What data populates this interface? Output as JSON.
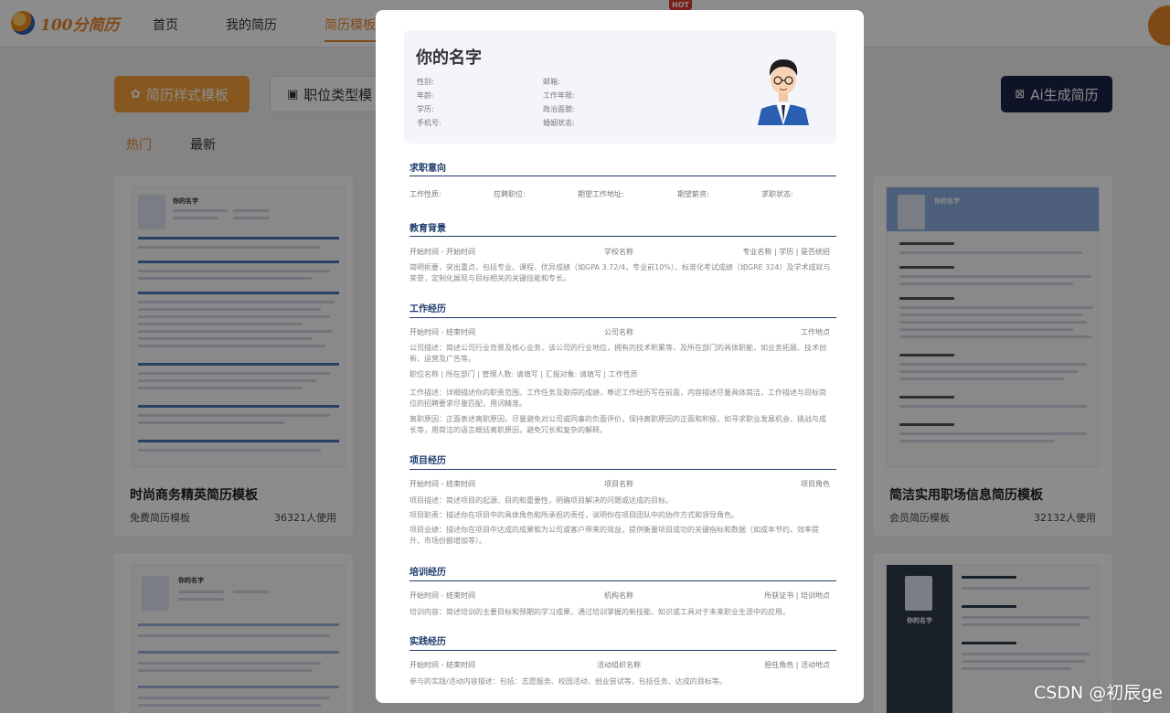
{
  "brand": {
    "logo_text": "100分简历"
  },
  "nav": {
    "items": [
      "首页",
      "我的简历",
      "简历模板"
    ],
    "hot_badge": "HOT"
  },
  "tabs": {
    "style_label": "简历样式模板",
    "job_label": "职位类型模",
    "ai_label": "Ai生成简历"
  },
  "filters": [
    "热门",
    "最新"
  ],
  "cards": [
    {
      "title": "时尚商务精英简历模板",
      "type": "免费简历模板",
      "uses": "36321人使用"
    },
    {
      "title": "简洁实用职场信息简历模板",
      "type": "会员简历模板",
      "uses": "32132人使用"
    }
  ],
  "thumb_text": {
    "name": "你的名字"
  },
  "resume": {
    "name": "你的名字",
    "info_left": [
      "性别:",
      "年龄:",
      "学历:",
      "手机号:"
    ],
    "info_right": [
      "邮箱:",
      "工作年限:",
      "政治面貌:",
      "婚姻状态:"
    ],
    "sections": {
      "intention": {
        "title": "求职意向",
        "fields": [
          "工作性质:",
          "应聘职位:",
          "期望工作地址:",
          "期望薪资:",
          "求职状态:"
        ]
      },
      "education": {
        "title": "教育背景",
        "time": "开始时间 - 开始时间",
        "middle": "学校名称",
        "right": "专业名称 | 学历 | 是否统招",
        "desc": "简明扼要，突出重点，包括专业、课程、优异成绩（如GPA 3.72/4，专业前10%）、标准化考试成绩（如GRE 324）及学术成就与荣誉，定制化展现与目标相关的关键技能和专长。"
      },
      "work": {
        "title": "工作经历",
        "time": "开始时间 - 结束时间",
        "middle": "公司名称",
        "right": "工作地点",
        "company_desc": "公司描述：简述公司行业背景及核心业务，该公司的行业地位，拥有的技术积累等，及所在部门的具体职能，如业务拓展、技术创新、运营及广告等。",
        "position_line": "职位名称 | 所在部门 | 管理人数: 请填写 | 汇报对象: 请填写 | 工作性质",
        "work_desc": "工作描述：详细描述你的职责范围、工作任务及取得的成绩，尊近工作经历写在前面，内容描述尽量具体简洁，工作描述与目标岗位的招聘要求尽量匹配，用词精准。",
        "leave_reason": "离职原因：正面表述离职原因，尽量避免对公司或同事的负面评价，保持离职原因的正面和积极，如寻求职业发展机会、挑战与成长等，用简洁的语言概括离职原因，避免冗长和复杂的解释。"
      },
      "project": {
        "title": "项目经历",
        "time": "开始时间 - 结束时间",
        "middle": "项目名称",
        "right": "项目角色",
        "desc1": "项目描述：简述项目的起源、目的和重要性，明确项目解决的问题或达成的目标。",
        "desc2": "项目职责：描述你在项目中的具体角色和所承担的责任，说明你在项目团队中的协作方式和领导角色。",
        "desc3": "项目业绩：描述你在项目中达成的成果和为公司或客户带来的效益，提供衡量项目成功的关键指标和数据（如成本节约、效率提升、市场份额增加等）。"
      },
      "training": {
        "title": "培训经历",
        "time": "开始时间 - 结束时间",
        "middle": "机构名称",
        "right": "所获证书 | 培训地点",
        "desc": "培训内容：简述培训的主要目标和预期的学习成果，通过培训掌握的新技能、知识或工具对于未来职业生涯中的应用。"
      },
      "practice": {
        "title": "实践经历",
        "time": "开始时间 - 结束时间",
        "middle": "活动组织名称",
        "right": "担任角色 | 活动地点",
        "desc": "参与的实践/活动内容描述：包括：志愿服务、校园活动、创业尝试等，包括任务、达成的目标等。"
      }
    }
  },
  "watermark": "CSDN @初辰ge",
  "colors": {
    "accent": "#e8862a",
    "navy": "#1e3a6b",
    "ai_button": "#1d2449"
  }
}
